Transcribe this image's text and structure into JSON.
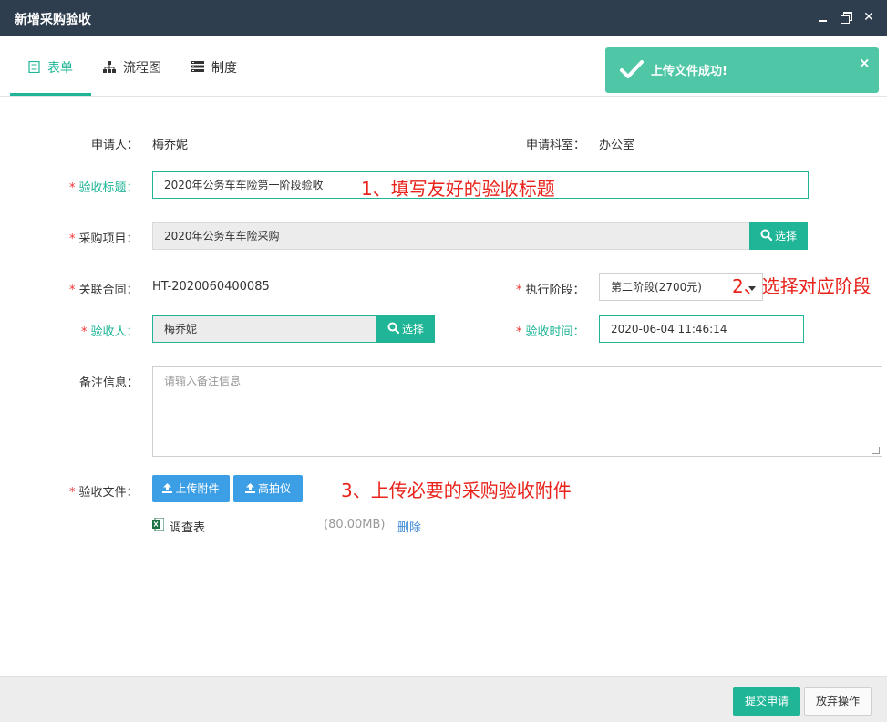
{
  "window": {
    "title": "新增采购验收"
  },
  "tabs": [
    {
      "label": "表单",
      "icon": "form-icon",
      "active": true
    },
    {
      "label": "流程图",
      "icon": "sitemap-icon"
    },
    {
      "label": "制度",
      "icon": "list-icon"
    }
  ],
  "toast": {
    "message": "上传文件成功!",
    "close": "×"
  },
  "form": {
    "applicant": {
      "label": "申请人：",
      "value": "梅乔妮"
    },
    "department": {
      "label": "申请科室：",
      "value": "办公室"
    },
    "title": {
      "label": "验收标题：",
      "value": "2020年公务车车险第一阶段验收"
    },
    "project": {
      "label": "采购项目：",
      "value": "2020年公务车车险采购",
      "button": "选择"
    },
    "contract": {
      "label": "关联合同：",
      "value": "HT-2020060400085"
    },
    "stage": {
      "label": "执行阶段：",
      "value": "第二阶段(2700元)"
    },
    "acceptor": {
      "label": "验收人：",
      "value": "梅乔妮",
      "button": "选择"
    },
    "time": {
      "label": "验收时间：",
      "value": "2020-06-04 11:46:14"
    },
    "remark": {
      "label": "备注信息：",
      "placeholder": "请输入备注信息"
    },
    "files": {
      "label": "验收文件：",
      "upload_button": "上传附件",
      "camera_button": "高拍仪",
      "items": [
        {
          "name": "调查表",
          "size": "(80.00MB)",
          "delete": "删除"
        }
      ]
    },
    "required_mark": "*"
  },
  "annotations": {
    "note1": "1、填写友好的验收标题",
    "note2": "2、选择对应阶段",
    "note3": "3、上传必要的采购验收附件"
  },
  "footer": {
    "submit": "提交申请",
    "cancel": "放弃操作"
  },
  "colors": {
    "accent": "#1fb596",
    "titlebar": "#2f3e4f",
    "toast": "#4fc6a6",
    "upload": "#3c9ee5",
    "annotation": "#e8231b"
  }
}
